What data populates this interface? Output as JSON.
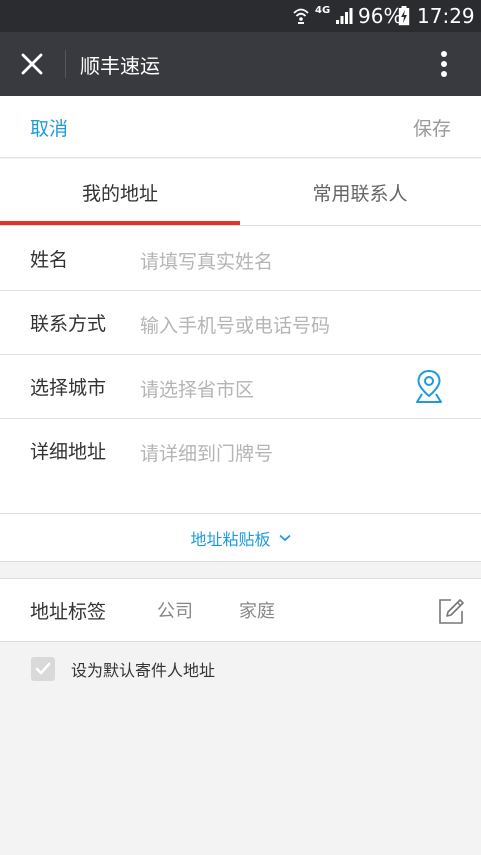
{
  "status_bar": {
    "network": "4G",
    "battery": "96%",
    "time": "17:29",
    "icons": [
      "wifi-icon",
      "signal-icon",
      "battery-charging-icon"
    ]
  },
  "titlebar": {
    "title": "顺丰速运",
    "close_icon": "close-icon",
    "more_icon": "more-vertical-icon"
  },
  "actions": {
    "cancel": "取消",
    "save": "保存"
  },
  "tabs": [
    {
      "label": "我的地址",
      "active": true
    },
    {
      "label": "常用联系人",
      "active": false
    }
  ],
  "form": {
    "name": {
      "label": "姓名",
      "placeholder": "请填写真实姓名"
    },
    "contact": {
      "label": "联系方式",
      "placeholder": "输入手机号或电话号码"
    },
    "city": {
      "label": "选择城市",
      "placeholder": "请选择省市区",
      "icon": "location-pin-icon"
    },
    "detail": {
      "label": "详细地址",
      "placeholder": "请详细到门牌号"
    }
  },
  "clipboard": {
    "label": "地址粘贴板",
    "icon": "chevron-down-icon"
  },
  "address_tag": {
    "label": "地址标签",
    "options": [
      "公司",
      "家庭"
    ],
    "edit_icon": "edit-icon"
  },
  "default_sender": {
    "label": "设为默认寄件人地址",
    "checked": true
  },
  "colors": {
    "accent_blue": "#1e9bdc",
    "tab_active_red": "#e5322d",
    "titlebar": "#393a3f",
    "statusbar": "#2b2c2f"
  }
}
